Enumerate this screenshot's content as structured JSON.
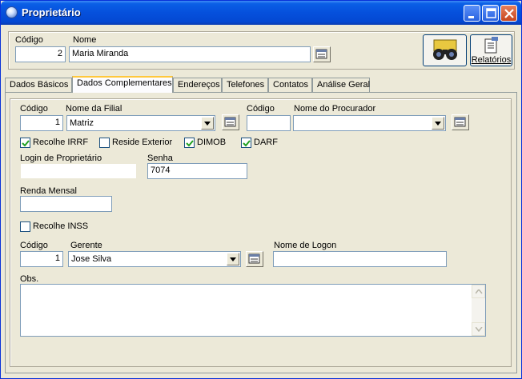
{
  "window": {
    "title": "Proprietário"
  },
  "header": {
    "codigo_label": "Código",
    "codigo_value": "2",
    "nome_label": "Nome",
    "nome_value": "Maria Miranda",
    "relatorios_label": "Relatórios"
  },
  "tabs": [
    {
      "label": "Dados Básicos",
      "active": false
    },
    {
      "label": "Dados Complementares",
      "active": true
    },
    {
      "label": "Endereços",
      "active": false
    },
    {
      "label": "Telefones",
      "active": false
    },
    {
      "label": "Contatos",
      "active": false
    },
    {
      "label": "Análise Geral",
      "active": false
    }
  ],
  "form": {
    "filial_codigo_label": "Código",
    "filial_codigo_value": "1",
    "filial_nome_label": "Nome da Filial",
    "filial_nome_value": "Matriz",
    "procurador_codigo_label": "Código",
    "procurador_codigo_value": "",
    "procurador_nome_label": "Nome do Procurador",
    "procurador_nome_value": "",
    "checks": [
      {
        "label": "Recolhe IRRF",
        "checked": true
      },
      {
        "label": "Reside Exterior",
        "checked": false
      },
      {
        "label": "DIMOB",
        "checked": true
      },
      {
        "label": "DARF",
        "checked": true
      }
    ],
    "login_label": "Login de Proprietário",
    "login_value": "",
    "senha_label": "Senha",
    "senha_value": "7074",
    "renda_label": "Renda Mensal",
    "renda_value": "",
    "inss_label": "Recolhe INSS",
    "inss_checked": false,
    "gerente_codigo_label": "Código",
    "gerente_codigo_value": "1",
    "gerente_label": "Gerente",
    "gerente_value": "Jose Silva",
    "logon_label": "Nome de Logon",
    "logon_value": "",
    "obs_label": "Obs.",
    "obs_value": ""
  },
  "icons": {
    "lookup": "lookup-grid-icon",
    "search": "binoculars-icon",
    "report": "report-icon",
    "minimize": "minimize-icon",
    "maximize": "maximize-icon",
    "close": "close-icon"
  },
  "colors": {
    "titlebar": "#0550dc",
    "active_tab_accent": "#ffc83c",
    "checkmark": "#21a121"
  }
}
